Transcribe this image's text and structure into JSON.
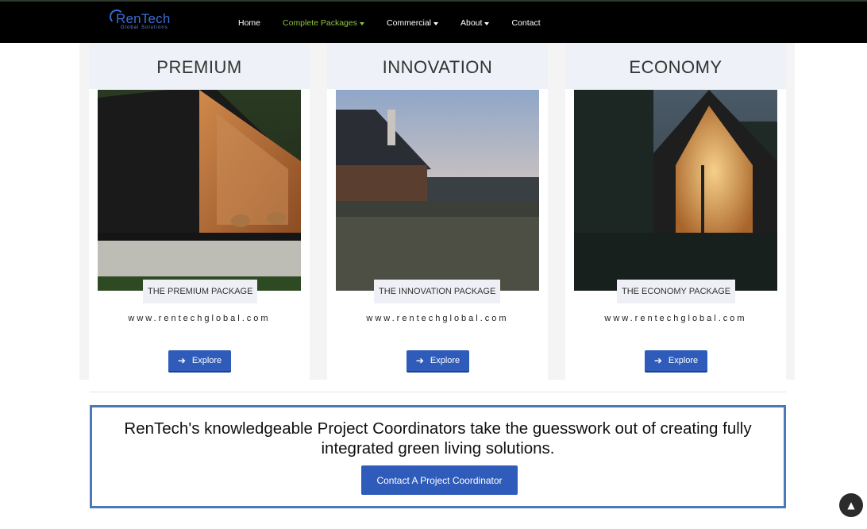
{
  "brand": {
    "name": "RenTech",
    "tagline": "Global Solutions"
  },
  "nav": {
    "items": [
      {
        "label": "Home",
        "dropdown": false,
        "active": false
      },
      {
        "label": "Complete Packages",
        "dropdown": true,
        "active": true
      },
      {
        "label": "Commercial",
        "dropdown": true,
        "active": false
      },
      {
        "label": "About",
        "dropdown": true,
        "active": false
      },
      {
        "label": "Contact",
        "dropdown": false,
        "active": false
      }
    ]
  },
  "packages": [
    {
      "title": "PREMIUM",
      "label": "THE PREMIUM PACKAGE",
      "url": "www.rentechglobal.com",
      "button": "Explore"
    },
    {
      "title": "INNOVATION",
      "label": "THE INNOVATION PACKAGE",
      "url": "www.rentechglobal.com",
      "button": "Explore"
    },
    {
      "title": "ECONOMY",
      "label": "THE ECONOMY PACKAGE",
      "url": "www.rentechglobal.com",
      "button": "Explore"
    }
  ],
  "cta": {
    "text": "RenTech's knowledgeable Project Coordinators take the guesswork out of creating fully integrated green living solutions.",
    "button": "Contact A Project Coordinator"
  },
  "icons": {
    "explore": "arrow-right-icon",
    "scroll_top": "chevron-up-icon"
  },
  "colors": {
    "accent": "#2f5cba",
    "nav_active": "#8dc63f",
    "cta_border": "#4a78b8"
  }
}
